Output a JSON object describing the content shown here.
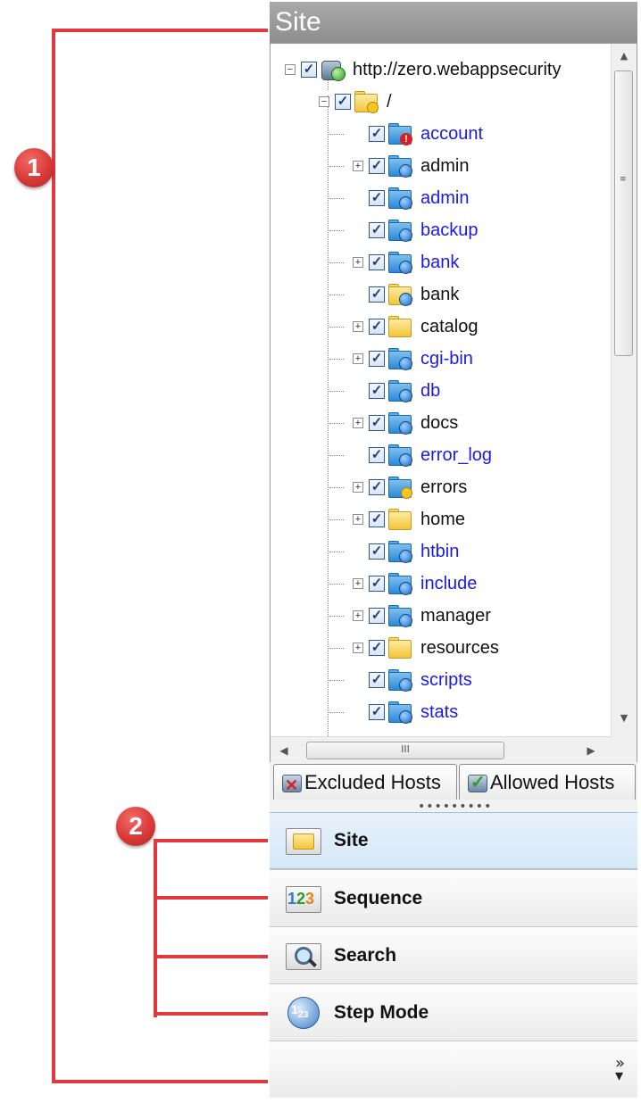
{
  "annotations": {
    "badge1": "1",
    "badge2": "2"
  },
  "panel": {
    "title": "Site",
    "tree": {
      "root_label": "http://zero.webappsecurity",
      "root_child_label": "/",
      "items": [
        {
          "label": "account",
          "color": "blue",
          "icon": "blue-folder-error-icon",
          "expandable": false
        },
        {
          "label": "admin",
          "color": "black",
          "icon": "blue-folder-globe-icon",
          "expandable": true
        },
        {
          "label": "admin",
          "color": "blue",
          "icon": "blue-folder-globe-icon",
          "expandable": false
        },
        {
          "label": "backup",
          "color": "blue",
          "icon": "blue-folder-globe-icon",
          "expandable": false
        },
        {
          "label": "bank",
          "color": "blue",
          "icon": "blue-folder-globe-icon",
          "expandable": true
        },
        {
          "label": "bank",
          "color": "black",
          "icon": "yellow-folder-globe-icon",
          "expandable": false
        },
        {
          "label": "catalog",
          "color": "black",
          "icon": "yellow-folder-icon",
          "expandable": true
        },
        {
          "label": "cgi-bin",
          "color": "blue",
          "icon": "blue-folder-globe-icon",
          "expandable": true
        },
        {
          "label": "db",
          "color": "blue",
          "icon": "blue-folder-globe-icon",
          "expandable": false
        },
        {
          "label": "docs",
          "color": "black",
          "icon": "blue-folder-globe-icon",
          "expandable": true
        },
        {
          "label": "error_log",
          "color": "blue",
          "icon": "blue-folder-globe-icon",
          "expandable": false
        },
        {
          "label": "errors",
          "color": "black",
          "icon": "blue-folder-lock-icon",
          "expandable": true
        },
        {
          "label": "home",
          "color": "black",
          "icon": "yellow-folder-icon",
          "expandable": true
        },
        {
          "label": "htbin",
          "color": "blue",
          "icon": "blue-folder-globe-icon",
          "expandable": false
        },
        {
          "label": "include",
          "color": "blue",
          "icon": "blue-folder-globe-icon",
          "expandable": true
        },
        {
          "label": "manager",
          "color": "black",
          "icon": "blue-folder-globe-icon",
          "expandable": true
        },
        {
          "label": "resources",
          "color": "black",
          "icon": "yellow-folder-icon",
          "expandable": true
        },
        {
          "label": "scripts",
          "color": "blue",
          "icon": "blue-folder-globe-icon",
          "expandable": false
        },
        {
          "label": "stats",
          "color": "blue",
          "icon": "blue-folder-globe-icon",
          "expandable": false
        }
      ]
    },
    "tabs": {
      "excluded_label": "Excluded Hosts",
      "allowed_label": "Allowed Hosts"
    },
    "nav": {
      "site_label": "Site",
      "sequence_label": "Sequence",
      "search_label": "Search",
      "stepmode_label": "Step Mode"
    },
    "colors": {
      "link_blue": "#1a1ae8",
      "annotation_red": "#e0393e",
      "header_gray": "#9a9a9a"
    }
  }
}
